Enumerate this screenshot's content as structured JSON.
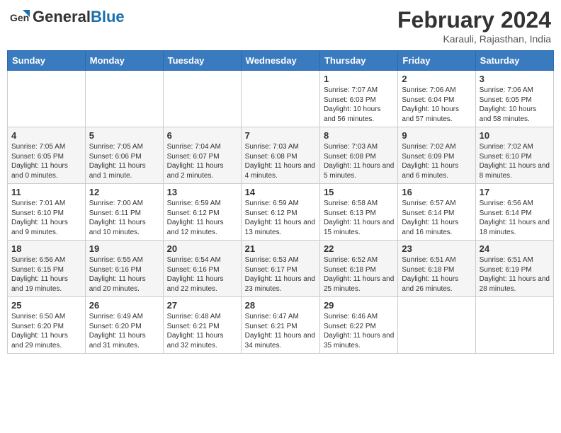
{
  "header": {
    "logo_general": "General",
    "logo_blue": "Blue",
    "month_title": "February 2024",
    "subtitle": "Karauli, Rajasthan, India"
  },
  "weekdays": [
    "Sunday",
    "Monday",
    "Tuesday",
    "Wednesday",
    "Thursday",
    "Friday",
    "Saturday"
  ],
  "weeks": [
    [
      {
        "day": "",
        "info": ""
      },
      {
        "day": "",
        "info": ""
      },
      {
        "day": "",
        "info": ""
      },
      {
        "day": "",
        "info": ""
      },
      {
        "day": "1",
        "info": "Sunrise: 7:07 AM\nSunset: 6:03 PM\nDaylight: 10 hours and 56 minutes."
      },
      {
        "day": "2",
        "info": "Sunrise: 7:06 AM\nSunset: 6:04 PM\nDaylight: 10 hours and 57 minutes."
      },
      {
        "day": "3",
        "info": "Sunrise: 7:06 AM\nSunset: 6:05 PM\nDaylight: 10 hours and 58 minutes."
      }
    ],
    [
      {
        "day": "4",
        "info": "Sunrise: 7:05 AM\nSunset: 6:05 PM\nDaylight: 11 hours and 0 minutes."
      },
      {
        "day": "5",
        "info": "Sunrise: 7:05 AM\nSunset: 6:06 PM\nDaylight: 11 hours and 1 minute."
      },
      {
        "day": "6",
        "info": "Sunrise: 7:04 AM\nSunset: 6:07 PM\nDaylight: 11 hours and 2 minutes."
      },
      {
        "day": "7",
        "info": "Sunrise: 7:03 AM\nSunset: 6:08 PM\nDaylight: 11 hours and 4 minutes."
      },
      {
        "day": "8",
        "info": "Sunrise: 7:03 AM\nSunset: 6:08 PM\nDaylight: 11 hours and 5 minutes."
      },
      {
        "day": "9",
        "info": "Sunrise: 7:02 AM\nSunset: 6:09 PM\nDaylight: 11 hours and 6 minutes."
      },
      {
        "day": "10",
        "info": "Sunrise: 7:02 AM\nSunset: 6:10 PM\nDaylight: 11 hours and 8 minutes."
      }
    ],
    [
      {
        "day": "11",
        "info": "Sunrise: 7:01 AM\nSunset: 6:10 PM\nDaylight: 11 hours and 9 minutes."
      },
      {
        "day": "12",
        "info": "Sunrise: 7:00 AM\nSunset: 6:11 PM\nDaylight: 11 hours and 10 minutes."
      },
      {
        "day": "13",
        "info": "Sunrise: 6:59 AM\nSunset: 6:12 PM\nDaylight: 11 hours and 12 minutes."
      },
      {
        "day": "14",
        "info": "Sunrise: 6:59 AM\nSunset: 6:12 PM\nDaylight: 11 hours and 13 minutes."
      },
      {
        "day": "15",
        "info": "Sunrise: 6:58 AM\nSunset: 6:13 PM\nDaylight: 11 hours and 15 minutes."
      },
      {
        "day": "16",
        "info": "Sunrise: 6:57 AM\nSunset: 6:14 PM\nDaylight: 11 hours and 16 minutes."
      },
      {
        "day": "17",
        "info": "Sunrise: 6:56 AM\nSunset: 6:14 PM\nDaylight: 11 hours and 18 minutes."
      }
    ],
    [
      {
        "day": "18",
        "info": "Sunrise: 6:56 AM\nSunset: 6:15 PM\nDaylight: 11 hours and 19 minutes."
      },
      {
        "day": "19",
        "info": "Sunrise: 6:55 AM\nSunset: 6:16 PM\nDaylight: 11 hours and 20 minutes."
      },
      {
        "day": "20",
        "info": "Sunrise: 6:54 AM\nSunset: 6:16 PM\nDaylight: 11 hours and 22 minutes."
      },
      {
        "day": "21",
        "info": "Sunrise: 6:53 AM\nSunset: 6:17 PM\nDaylight: 11 hours and 23 minutes."
      },
      {
        "day": "22",
        "info": "Sunrise: 6:52 AM\nSunset: 6:18 PM\nDaylight: 11 hours and 25 minutes."
      },
      {
        "day": "23",
        "info": "Sunrise: 6:51 AM\nSunset: 6:18 PM\nDaylight: 11 hours and 26 minutes."
      },
      {
        "day": "24",
        "info": "Sunrise: 6:51 AM\nSunset: 6:19 PM\nDaylight: 11 hours and 28 minutes."
      }
    ],
    [
      {
        "day": "25",
        "info": "Sunrise: 6:50 AM\nSunset: 6:20 PM\nDaylight: 11 hours and 29 minutes."
      },
      {
        "day": "26",
        "info": "Sunrise: 6:49 AM\nSunset: 6:20 PM\nDaylight: 11 hours and 31 minutes."
      },
      {
        "day": "27",
        "info": "Sunrise: 6:48 AM\nSunset: 6:21 PM\nDaylight: 11 hours and 32 minutes."
      },
      {
        "day": "28",
        "info": "Sunrise: 6:47 AM\nSunset: 6:21 PM\nDaylight: 11 hours and 34 minutes."
      },
      {
        "day": "29",
        "info": "Sunrise: 6:46 AM\nSunset: 6:22 PM\nDaylight: 11 hours and 35 minutes."
      },
      {
        "day": "",
        "info": ""
      },
      {
        "day": "",
        "info": ""
      }
    ]
  ]
}
